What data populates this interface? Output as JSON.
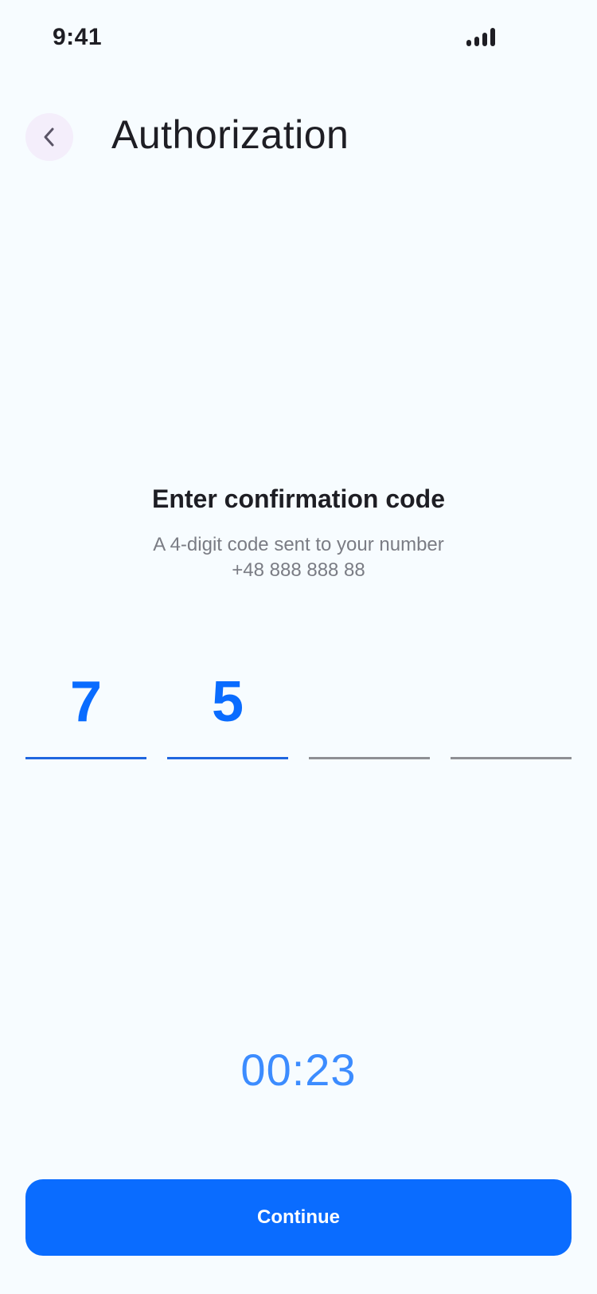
{
  "status_bar": {
    "time": "9:41",
    "signal_icon": "signal-bars-icon"
  },
  "header": {
    "back_icon": "chevron-left-icon",
    "title": "Authorization"
  },
  "prompt": {
    "heading": "Enter confirmation code",
    "subtext": "A 4-digit code sent to your number +48 888 888 88"
  },
  "code": {
    "digits": [
      "7",
      "5",
      "",
      ""
    ]
  },
  "timer": {
    "value": "00:23"
  },
  "actions": {
    "continue_label": "Continue"
  },
  "colors": {
    "background": "#F7FCFF",
    "accent": "#0A6CFF",
    "timer": "#3C8CFF",
    "active_underline": "#1F66E0",
    "inactive_underline": "#8E8F94",
    "back_button_bg": "#F4EEFB"
  }
}
